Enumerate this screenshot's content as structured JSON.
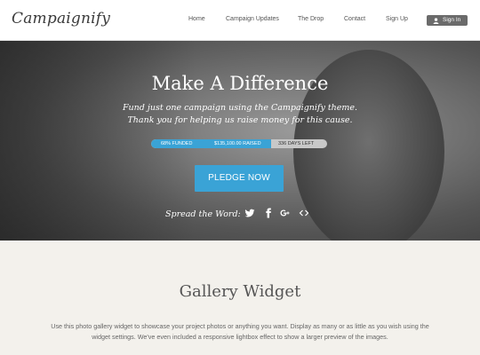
{
  "brand": {
    "logo_text": "Campaignify"
  },
  "nav": {
    "items": [
      "Home",
      "Campaign Updates",
      "The Drop",
      "Contact",
      "Sign Up"
    ],
    "signin_label": "Sign In"
  },
  "hero": {
    "title": "Make A Difference",
    "subtitle_line1": "Fund just one campaign using the Campaignify theme.",
    "subtitle_line2": "Thank you for helping us raise money for this cause.",
    "stats": {
      "funded": "68% FUNDED",
      "raised": "$135,100.00 RAISED",
      "days_left": "336 DAYS LEFT",
      "progress_fraction": 0.68
    },
    "cta_label": "PLEDGE NOW",
    "share_label": "Spread the Word:",
    "social_icons": [
      "twitter-icon",
      "facebook-icon",
      "google-plus-icon",
      "embed-code-icon"
    ]
  },
  "gallery": {
    "title": "Gallery Widget",
    "description": "Use this photo gallery widget to showcase your project photos or anything you want. Display as many or as little as you wish using the widget settings. We've even included a responsive lightbox effect to show a larger preview of the images."
  },
  "colors": {
    "accent": "#3aa3d6",
    "header_bg": "#ffffff",
    "page_bg": "#f3f1ec",
    "signin_bg": "#6b6b6b"
  }
}
